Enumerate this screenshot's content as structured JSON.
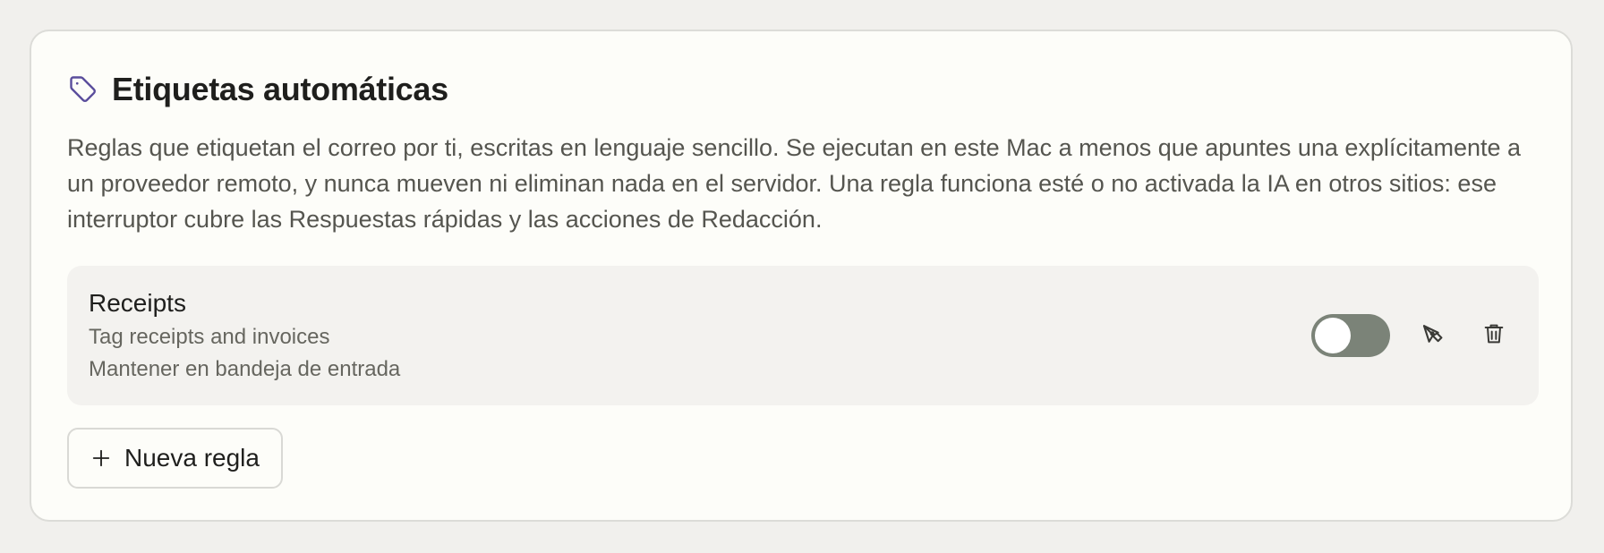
{
  "section": {
    "icon": "tag-icon",
    "title": "Etiquetas automáticas",
    "description": "Reglas que etiquetan el correo por ti, escritas en lenguaje sencillo. Se ejecutan en este Mac a menos que apuntes una explícitamente a un proveedor remoto, y nunca mueven ni eliminan nada en el servidor. Una regla funciona esté o no activada la IA en otros sitios: ese interruptor cubre las Respuestas rápidas y las acciones de Redacción."
  },
  "rules": [
    {
      "name": "Receipts",
      "description": "Tag receipts and invoices",
      "action": "Mantener en bandeja de entrada",
      "enabled": false,
      "edit_icon": "pen-icon",
      "delete_icon": "trash-icon"
    }
  ],
  "new_rule_button": {
    "icon": "plus-icon",
    "label": "Nueva regla"
  },
  "colors": {
    "accent": "#5a4d9c",
    "toggle_track": "#7b8378",
    "card_background": "#fdfdf9",
    "page_background": "#f1f0ed"
  }
}
